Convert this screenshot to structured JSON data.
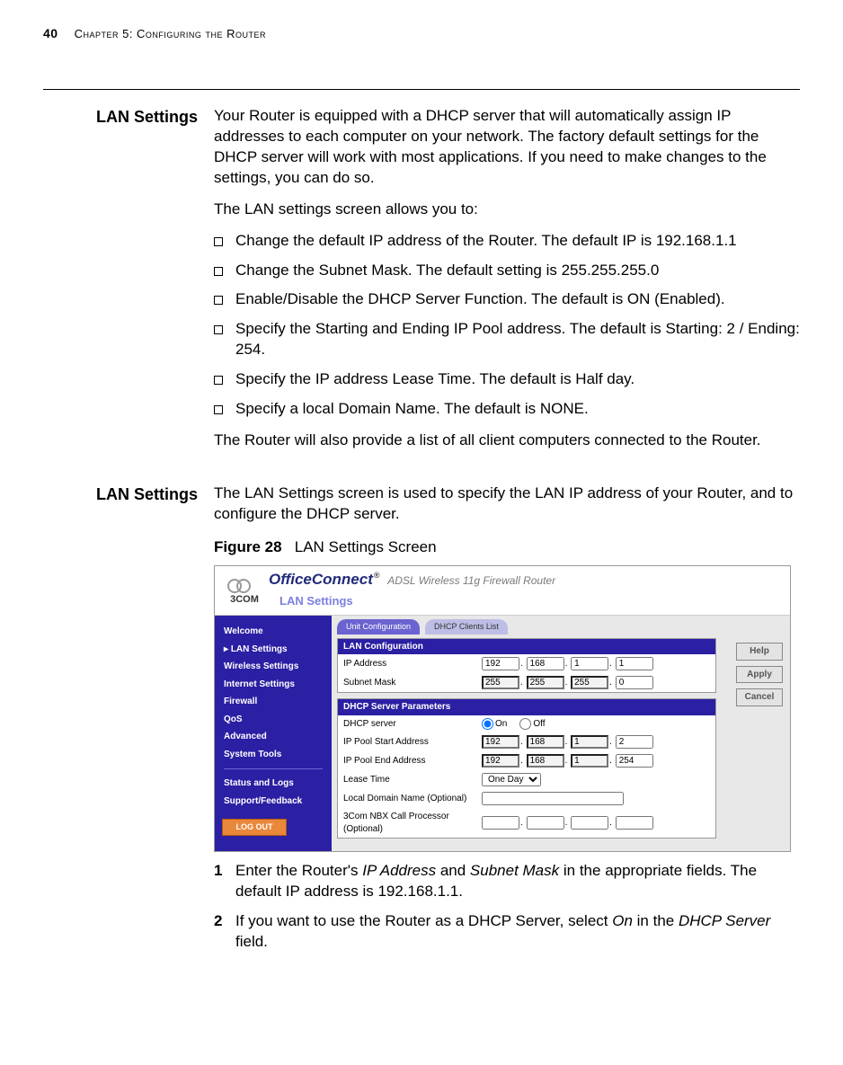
{
  "header": {
    "page_number": "40",
    "chapter_label": "Chapter 5: Configuring the Router"
  },
  "section1": {
    "heading": "LAN Settings",
    "para1": "Your Router is equipped with a DHCP server that will automatically assign IP addresses to each computer on your network. The factory default settings for the DHCP server will work with most applications. If you need to make changes to the settings, you can do so.",
    "para2": "The LAN settings screen allows you to:",
    "bullets": [
      "Change the default IP address of the Router. The default IP is 192.168.1.1",
      "Change the Subnet Mask. The default setting is 255.255.255.0",
      "Enable/Disable the DHCP Server Function. The default is ON (Enabled).",
      "Specify the Starting and Ending IP Pool address. The default is Starting: 2 / Ending: 254.",
      "Specify the IP address Lease Time. The default is Half day.",
      "Specify a local Domain Name. The default is NONE."
    ],
    "para3": "The Router will also provide a list of all client computers connected to the Router."
  },
  "section2": {
    "heading": "LAN Settings",
    "para1": "The LAN Settings screen is used to specify the LAN IP address of your Router, and to configure the DHCP server.",
    "figure": {
      "number": "Figure 28",
      "caption": "LAN Settings Screen"
    },
    "step1_a": "Enter the Router's ",
    "step1_b": " and ",
    "step1_c": " in the appropriate fields. The default IP address is 192.168.1.1.",
    "step1_ip": "IP Address",
    "step1_mask": "Subnet Mask",
    "step2_a": "If you want to use the Router as a DHCP Server, select ",
    "step2_b": " in the ",
    "step2_c": " field.",
    "step2_on": "On",
    "step2_field": "DHCP Server"
  },
  "screenshot": {
    "brand_logo_text": "3COM",
    "product_line": "OfficeConnect",
    "product_suffix": "®",
    "product_desc": "ADSL Wireless 11g Firewall Router",
    "page_title": "LAN Settings",
    "tabs": {
      "active": "Unit Configuration",
      "inactive": "DHCP Clients List"
    },
    "nav": {
      "items": [
        "Welcome",
        "LAN Settings",
        "Wireless Settings",
        "Internet Settings",
        "Firewall",
        "QoS",
        "Advanced",
        "System Tools"
      ],
      "selected": "LAN Settings",
      "items2": [
        "Status and Logs",
        "Support/Feedback"
      ],
      "logout": "LOG OUT"
    },
    "panels": {
      "lan": {
        "title": "LAN Configuration",
        "ip_label": "IP Address",
        "ip": [
          "192",
          "168",
          "1",
          "1"
        ],
        "mask_label": "Subnet Mask",
        "mask": [
          "255",
          "255",
          "255",
          "0"
        ]
      },
      "dhcp": {
        "title": "DHCP Server Parameters",
        "server_label": "DHCP server",
        "server_on": "On",
        "server_off": "Off",
        "start_label": "IP Pool Start Address",
        "start": [
          "192",
          "168",
          "1",
          "2"
        ],
        "end_label": "IP Pool End Address",
        "end": [
          "192",
          "168",
          "1",
          "254"
        ],
        "lease_label": "Lease Time",
        "lease_value": "One Day",
        "domain_label": "Local Domain Name (Optional)",
        "domain_value": "",
        "nbx_label": "3Com NBX Call Processor (Optional)",
        "nbx": [
          "",
          "",
          "",
          ""
        ]
      }
    },
    "buttons": {
      "help": "Help",
      "apply": "Apply",
      "cancel": "Cancel"
    }
  }
}
